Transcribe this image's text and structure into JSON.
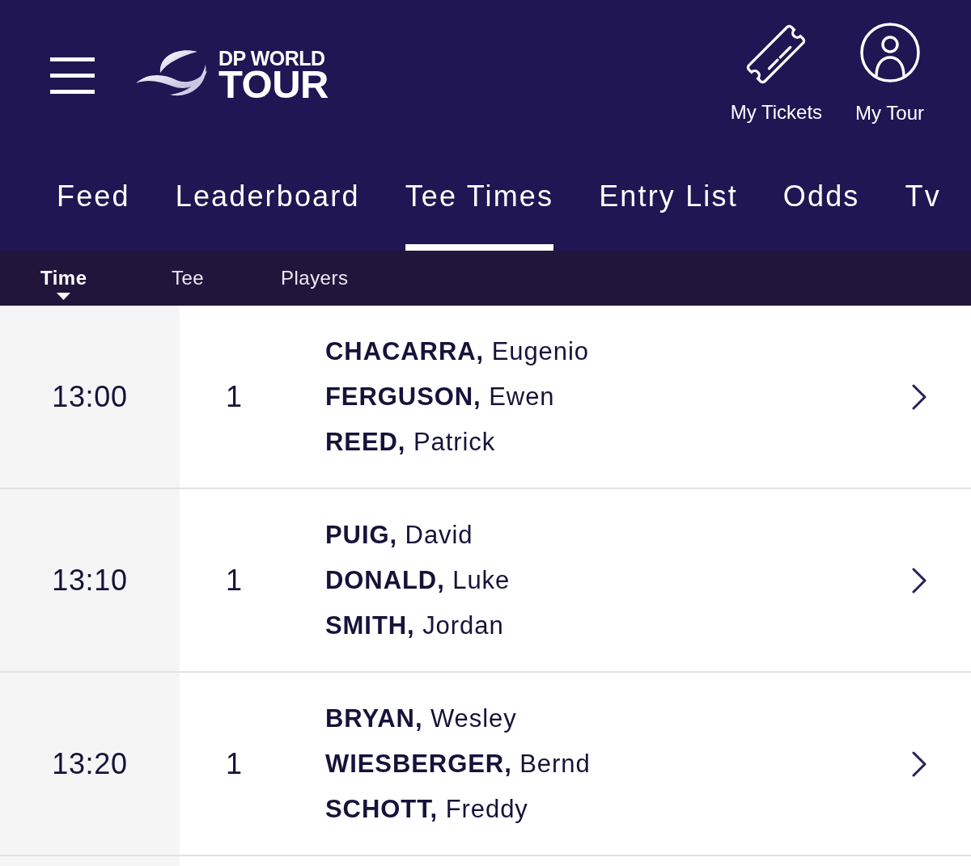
{
  "logo": {
    "line_1": "DP WORLD",
    "line_2": "TOUR"
  },
  "header_links": [
    {
      "kind": "tickets",
      "label": "My Tickets"
    },
    {
      "kind": "account",
      "label": "My Tour"
    }
  ],
  "tabs": [
    {
      "label": "Feed",
      "selected": false
    },
    {
      "label": "Leaderboard",
      "selected": false
    },
    {
      "label": "Tee Times",
      "selected": true
    },
    {
      "label": "Entry List",
      "selected": false
    },
    {
      "label": "Odds",
      "selected": false
    },
    {
      "label": "Tv",
      "selected": false
    }
  ],
  "sort_columns": [
    {
      "label": "Time",
      "selected": true
    },
    {
      "label": "Tee",
      "selected": false
    },
    {
      "label": "Players",
      "selected": false
    }
  ],
  "tee_times": [
    {
      "time": "13:00",
      "tee": "1",
      "players": [
        "**CHACARRA,** Eugenio",
        "**FERGUSON,** Ewen",
        "**REED,** Patrick"
      ]
    },
    {
      "time": "13:10",
      "tee": "1",
      "players": [
        "**PUIG,** David",
        "**DONALD,** Luke",
        "**SMITH,** Jordan"
      ]
    },
    {
      "time": "13:20",
      "tee": "1",
      "players": [
        "**BRYAN,** Wesley",
        "**WIESBERGER,** Bernd",
        "**SCHOTT,** Freddy"
      ]
    }
  ]
}
